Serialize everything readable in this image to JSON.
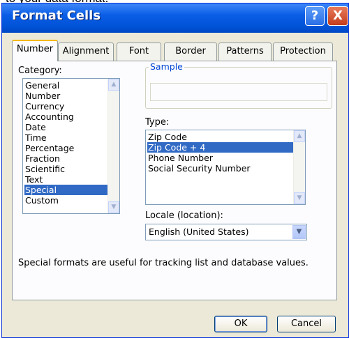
{
  "page_fragment": "to your data format.",
  "window": {
    "title": "Format Cells",
    "help_button": "?",
    "close_button": "X"
  },
  "tabs": [
    {
      "label": "Number",
      "active": true
    },
    {
      "label": "Alignment",
      "active": false
    },
    {
      "label": "Font",
      "active": false
    },
    {
      "label": "Border",
      "active": false
    },
    {
      "label": "Patterns",
      "active": false
    },
    {
      "label": "Protection",
      "active": false
    }
  ],
  "category": {
    "label": "Category:",
    "items": [
      "General",
      "Number",
      "Currency",
      "Accounting",
      "Date",
      "Time",
      "Percentage",
      "Fraction",
      "Scientific",
      "Text",
      "Special",
      "Custom"
    ],
    "selected": "Special"
  },
  "sample": {
    "legend": "Sample",
    "value": ""
  },
  "type": {
    "label": "Type:",
    "items": [
      "Zip Code",
      "Zip Code + 4",
      "Phone Number",
      "Social Security Number"
    ],
    "selected": "Zip Code + 4"
  },
  "locale": {
    "label": "Locale (location):",
    "value": "English (United States)"
  },
  "description": "Special formats are useful for tracking list and database values.",
  "buttons": {
    "ok": "OK",
    "cancel": "Cancel"
  },
  "colors": {
    "title_bar": "#0a5de6",
    "selection": "#316ac5",
    "dialog_face": "#ece9d8",
    "sample_legend": "#0046d5"
  },
  "icons": {
    "scroll_up": "triangle-up",
    "scroll_down": "triangle-down",
    "dropdown": "chevron-down"
  }
}
